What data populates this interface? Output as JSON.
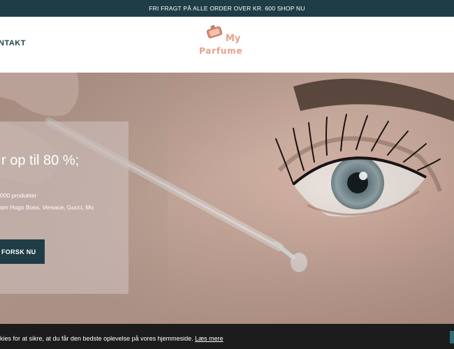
{
  "announcement": {
    "text": "FRI FRAGT PÅ ALLE ORDER OVER KR. 600  SHOP NU"
  },
  "header": {
    "nav_contact": "NTAKT",
    "logo": {
      "line1": "My",
      "line2": "Parfume"
    }
  },
  "hero": {
    "title": "r op til 80 %;",
    "line1": "000 produkter",
    "line2": "om Hugo Boss, Versace, Gucci, Mv.",
    "cta": "FORSK NU"
  },
  "cookie_bar": {
    "text": "kies for at sikre, at du får den bedste oplevelse på vores hjemmeside.",
    "link": "Læs mere"
  },
  "colors": {
    "brand_dark": "#1f3d47",
    "logo_accent": "#e8a18a",
    "cookie_bg": "#1c1c1c"
  }
}
